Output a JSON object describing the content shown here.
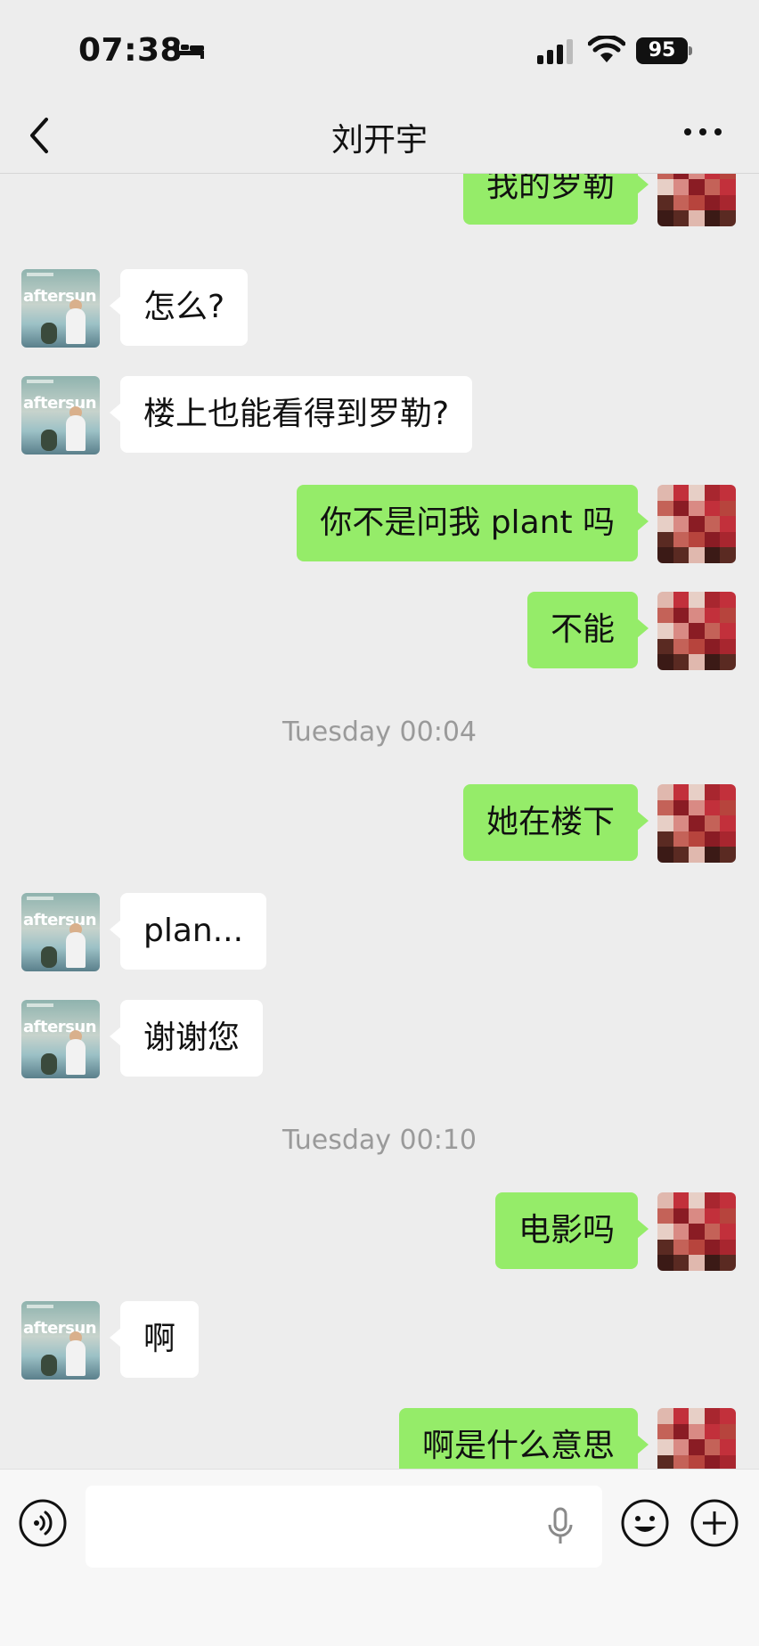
{
  "status_bar": {
    "time": "07:38",
    "battery": "95"
  },
  "nav": {
    "title": "刘开宇"
  },
  "messages": [
    {
      "side": "out",
      "text": "我的罗勒"
    },
    {
      "side": "in",
      "text": "怎么?"
    },
    {
      "side": "in",
      "text": "楼上也能看得到罗勒?"
    },
    {
      "side": "out",
      "text": "你不是问我 plant 吗"
    },
    {
      "side": "out",
      "text": "不能"
    },
    {
      "timestamp": "Tuesday 00:04"
    },
    {
      "side": "out",
      "text": "她在楼下"
    },
    {
      "side": "in",
      "text": "plan..."
    },
    {
      "side": "in",
      "text": "谢谢您"
    },
    {
      "timestamp": "Tuesday 00:10"
    },
    {
      "side": "out",
      "text": "电影吗"
    },
    {
      "side": "in",
      "text": "啊"
    },
    {
      "side": "out",
      "text": "啊是什么意思"
    }
  ],
  "contact_avatar": {
    "text": "aftersun"
  },
  "input_bar": {
    "value": "",
    "placeholder": ""
  },
  "colors": {
    "background": "#ededed",
    "outgoing_bubble": "#95ec69",
    "incoming_bubble": "#ffffff",
    "timestamp": "#9a9a9a"
  }
}
